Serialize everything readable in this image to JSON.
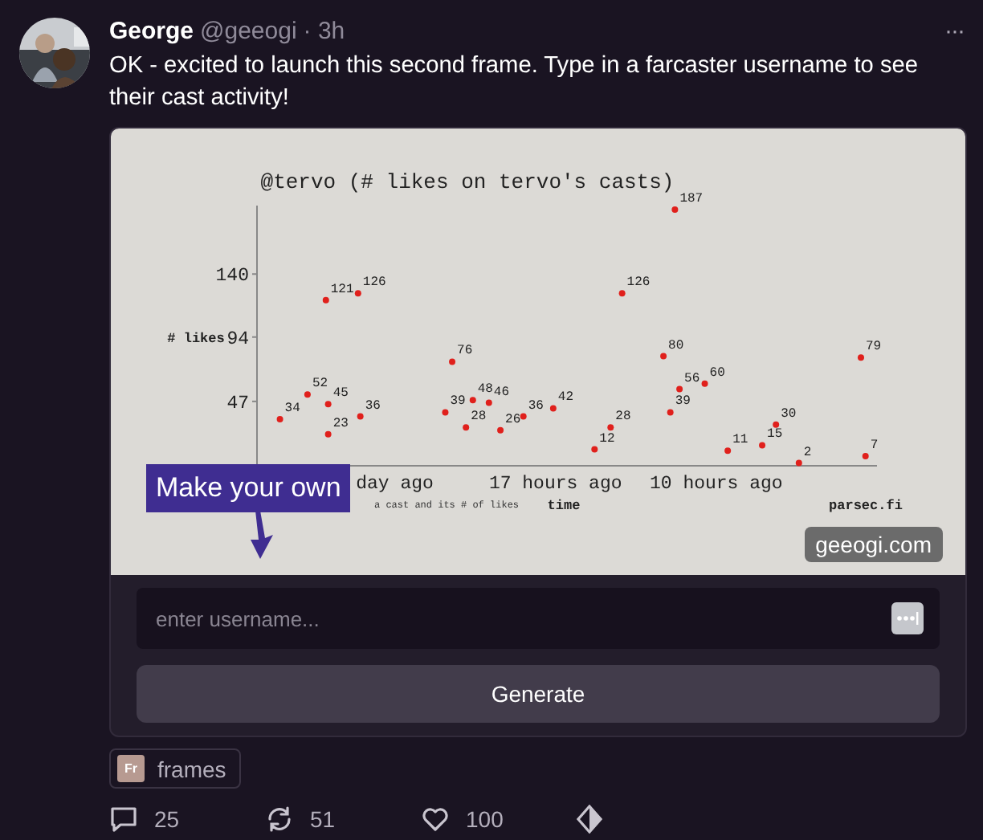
{
  "post": {
    "author": "George",
    "handle": "@geeogi",
    "time": "· 3h",
    "text": "OK - excited to launch this second frame. Type in a farcaster username to see their cast activity!",
    "more": "···"
  },
  "frame": {
    "image": {
      "chart_data": {
        "type": "scatter",
        "title": "@tervo (# likes on tervo's casts)",
        "xlabel": "time",
        "ylabel": "# likes",
        "xlim": [
          -30,
          -3
        ],
        "ylim": [
          0,
          190
        ],
        "yticks": [
          47,
          94,
          140
        ],
        "xticks": [
          {
            "value": -24,
            "label": "day ago"
          },
          {
            "value": -17,
            "label": "17 hours ago"
          },
          {
            "value": -10,
            "label": "10 hours ago"
          }
        ],
        "data_labels": true,
        "x": [
          -27.0,
          -25.6,
          -27.8,
          -26.9,
          -29.0,
          -26.9,
          -25.5,
          -21.5,
          -21.8,
          -20.6,
          -19.9,
          -18.4,
          -19.4,
          -20.9,
          -11.8,
          -14.1,
          -12.3,
          -3.7,
          -10.5,
          -11.6,
          -12.0,
          -17.1,
          -14.6,
          -7.4,
          -8.0,
          -9.5,
          -15.3,
          -6.4,
          -3.5
        ],
        "series": [
          {
            "color": "#e0201c",
            "values": [
              121,
              126,
              52,
              45,
              34,
              23,
              36,
              76,
              39,
              48,
              46,
              36,
              26,
              28,
              187,
              126,
              80,
              79,
              60,
              56,
              39,
              42,
              28,
              30,
              15,
              11,
              12,
              2,
              7
            ]
          }
        ]
      },
      "note": "a cast and its # of likes",
      "credit": "parsec.fi"
    },
    "overlay_button": "Make your own",
    "site_badge": "geeogi.com",
    "input": {
      "placeholder": "enter username..."
    },
    "button": "Generate"
  },
  "channel": {
    "badge": "Fr",
    "name": "frames"
  },
  "actions": [
    {
      "kind": "reply",
      "count": "25"
    },
    {
      "kind": "recast",
      "count": "51"
    },
    {
      "kind": "like",
      "count": "100"
    },
    {
      "kind": "collect"
    }
  ]
}
